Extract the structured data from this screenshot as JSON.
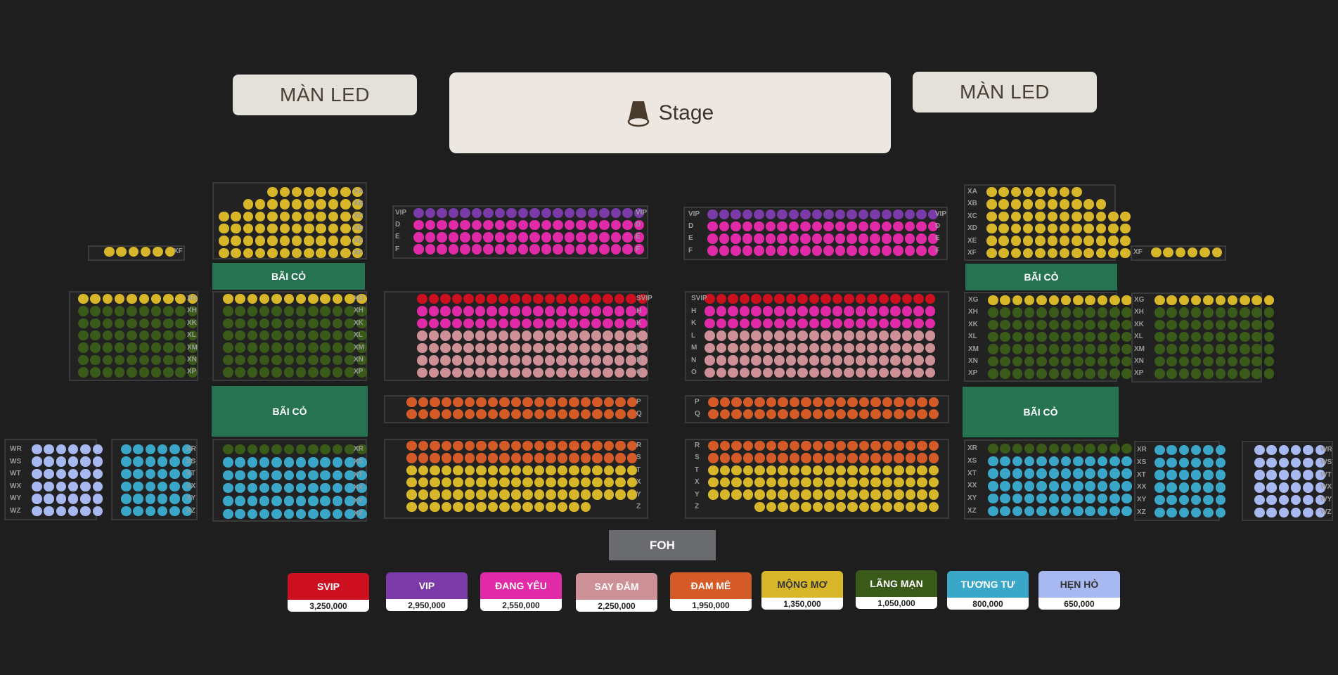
{
  "colors": {
    "svip": "#cc1020",
    "vip": "#7a3aa8",
    "dang_yeu": "#e02aa8",
    "say_dam": "#cc9096",
    "dam_me": "#d45a28",
    "mong_mo": "#d8b62a",
    "lang_man": "#3a5a1a",
    "tuong_tu": "#3aa6c8",
    "hen_ho": "#a8b8f0"
  },
  "screens": {
    "left_label": "MÀN LED",
    "right_label": "MÀN LED"
  },
  "stage": {
    "icon": "spotlight-icon",
    "label": "Stage"
  },
  "grass_label": "BÃI CỎ",
  "foh_label": "FOH",
  "sections": [
    {
      "id": "far-left-xf",
      "rows": [
        {
          "label": "XF",
          "count": 6,
          "color": "mong_mo"
        }
      ],
      "labels_right": true
    },
    {
      "id": "far-left-mid",
      "rows": [
        {
          "label": "XG",
          "count": 10,
          "color": "mong_mo"
        },
        {
          "label": "XH",
          "count": 10,
          "color": "lang_man"
        },
        {
          "label": "XK",
          "count": 10,
          "color": "lang_man"
        },
        {
          "label": "XL",
          "count": 10,
          "color": "lang_man"
        },
        {
          "label": "XM",
          "count": 10,
          "color": "lang_man"
        },
        {
          "label": "XN",
          "count": 10,
          "color": "lang_man"
        },
        {
          "label": "XP",
          "count": 10,
          "color": "lang_man"
        }
      ],
      "labels_right": true
    },
    {
      "id": "far-left-bottom-a",
      "rows": [
        {
          "label": "WR",
          "count": 6,
          "color": "hen_ho"
        },
        {
          "label": "WS",
          "count": 6,
          "color": "hen_ho"
        },
        {
          "label": "WT",
          "count": 6,
          "color": "hen_ho"
        },
        {
          "label": "WX",
          "count": 6,
          "color": "hen_ho"
        },
        {
          "label": "WY",
          "count": 6,
          "color": "hen_ho"
        },
        {
          "label": "WZ",
          "count": 6,
          "color": "hen_ho"
        }
      ],
      "labels_right": false
    },
    {
      "id": "far-left-bottom-b",
      "rows": [
        {
          "label": "XR",
          "count": 6,
          "color": "tuong_tu"
        },
        {
          "label": "XS",
          "count": 6,
          "color": "tuong_tu"
        },
        {
          "label": "XT",
          "count": 6,
          "color": "tuong_tu"
        },
        {
          "label": "XX",
          "count": 6,
          "color": "tuong_tu"
        },
        {
          "label": "XY",
          "count": 6,
          "color": "tuong_tu"
        },
        {
          "label": "XZ",
          "count": 6,
          "color": "tuong_tu"
        }
      ],
      "labels_right": true
    },
    {
      "id": "left-top",
      "rows": [
        {
          "label": "XA",
          "count": 8,
          "color": "mong_mo"
        },
        {
          "label": "XB",
          "count": 10,
          "color": "mong_mo"
        },
        {
          "label": "XC",
          "count": 12,
          "color": "mong_mo"
        },
        {
          "label": "XD",
          "count": 12,
          "color": "mong_mo"
        },
        {
          "label": "XE",
          "count": 12,
          "color": "mong_mo"
        },
        {
          "label": "XF",
          "count": 12,
          "color": "mong_mo"
        }
      ],
      "labels_right": true
    },
    {
      "id": "left-mid",
      "rows": [
        {
          "label": "XG",
          "count": 12,
          "color": "mong_mo"
        },
        {
          "label": "XH",
          "count": 12,
          "color": "lang_man"
        },
        {
          "label": "XK",
          "count": 12,
          "color": "lang_man"
        },
        {
          "label": "XL",
          "count": 12,
          "color": "lang_man"
        },
        {
          "label": "XM",
          "count": 12,
          "color": "lang_man"
        },
        {
          "label": "XN",
          "count": 12,
          "color": "lang_man"
        },
        {
          "label": "XP",
          "count": 12,
          "color": "lang_man"
        }
      ],
      "labels_right": true
    },
    {
      "id": "left-bottom",
      "rows": [
        {
          "label": "XR",
          "count": 12,
          "color": "lang_man"
        },
        {
          "label": "XS",
          "count": 12,
          "color": "tuong_tu"
        },
        {
          "label": "XT",
          "count": 12,
          "color": "tuong_tu"
        },
        {
          "label": "XX",
          "count": 12,
          "color": "tuong_tu"
        },
        {
          "label": "XY",
          "count": 12,
          "color": "tuong_tu"
        },
        {
          "label": "XZ",
          "count": 12,
          "color": "tuong_tu"
        }
      ],
      "labels_right": true
    },
    {
      "id": "center-left-vip",
      "rows": [
        {
          "label": "VIP",
          "count": 20,
          "color": "vip"
        },
        {
          "label": "D",
          "count": 20,
          "color": "dang_yeu"
        },
        {
          "label": "E",
          "count": 20,
          "color": "dang_yeu"
        },
        {
          "label": "F",
          "count": 20,
          "color": "dang_yeu"
        }
      ],
      "labels_both": true
    },
    {
      "id": "center-right-vip",
      "rows": [
        {
          "label": "VIP",
          "count": 20,
          "color": "vip"
        },
        {
          "label": "D",
          "count": 20,
          "color": "dang_yeu"
        },
        {
          "label": "E",
          "count": 20,
          "color": "dang_yeu"
        },
        {
          "label": "F",
          "count": 20,
          "color": "dang_yeu"
        }
      ],
      "labels_both": true
    },
    {
      "id": "center-left-mid",
      "rows": [
        {
          "label": "SVIP",
          "count": 20,
          "color": "svip"
        },
        {
          "label": "H",
          "count": 20,
          "color": "dang_yeu"
        },
        {
          "label": "K",
          "count": 20,
          "color": "dang_yeu"
        },
        {
          "label": "L",
          "count": 20,
          "color": "say_dam"
        },
        {
          "label": "M",
          "count": 20,
          "color": "say_dam"
        },
        {
          "label": "N",
          "count": 20,
          "color": "say_dam"
        },
        {
          "label": "O",
          "count": 20,
          "color": "say_dam"
        }
      ],
      "labels_right": true
    },
    {
      "id": "center-right-mid",
      "rows": [
        {
          "label": "SVIP",
          "count": 20,
          "color": "svip"
        },
        {
          "label": "H",
          "count": 20,
          "color": "dang_yeu"
        },
        {
          "label": "K",
          "count": 20,
          "color": "dang_yeu"
        },
        {
          "label": "L",
          "count": 20,
          "color": "say_dam"
        },
        {
          "label": "M",
          "count": 20,
          "color": "say_dam"
        },
        {
          "label": "N",
          "count": 20,
          "color": "say_dam"
        },
        {
          "label": "O",
          "count": 20,
          "color": "say_dam"
        }
      ],
      "labels_right": false
    },
    {
      "id": "center-left-pq",
      "rows": [
        {
          "label": "P",
          "count": 20,
          "color": "dam_me"
        },
        {
          "label": "Q",
          "count": 20,
          "color": "dam_me"
        }
      ],
      "labels_right": true
    },
    {
      "id": "center-right-pq",
      "rows": [
        {
          "label": "P",
          "count": 20,
          "color": "dam_me"
        },
        {
          "label": "Q",
          "count": 20,
          "color": "dam_me"
        }
      ],
      "labels_right": false
    },
    {
      "id": "center-left-bottom",
      "rows": [
        {
          "label": "R",
          "count": 20,
          "color": "dam_me"
        },
        {
          "label": "S",
          "count": 20,
          "color": "dam_me"
        },
        {
          "label": "T",
          "count": 20,
          "color": "mong_mo"
        },
        {
          "label": "X",
          "count": 20,
          "color": "mong_mo"
        },
        {
          "label": "Y",
          "count": 20,
          "color": "mong_mo"
        },
        {
          "label": "Z",
          "count": 16,
          "color": "mong_mo"
        }
      ],
      "labels_right": true
    },
    {
      "id": "center-right-bottom",
      "rows": [
        {
          "label": "R",
          "count": 20,
          "color": "dam_me"
        },
        {
          "label": "S",
          "count": 20,
          "color": "dam_me"
        },
        {
          "label": "T",
          "count": 20,
          "color": "mong_mo"
        },
        {
          "label": "X",
          "count": 20,
          "color": "mong_mo"
        },
        {
          "label": "Y",
          "count": 20,
          "color": "mong_mo"
        },
        {
          "label": "Z",
          "count": 16,
          "color": "mong_mo"
        }
      ],
      "labels_right": false
    },
    {
      "id": "right-top",
      "rows": [
        {
          "label": "XA",
          "count": 8,
          "color": "mong_mo"
        },
        {
          "label": "XB",
          "count": 10,
          "color": "mong_mo"
        },
        {
          "label": "XC",
          "count": 12,
          "color": "mong_mo"
        },
        {
          "label": "XD",
          "count": 12,
          "color": "mong_mo"
        },
        {
          "label": "XE",
          "count": 12,
          "color": "mong_mo"
        },
        {
          "label": "XF",
          "count": 12,
          "color": "mong_mo"
        }
      ],
      "labels_right": false
    },
    {
      "id": "right-mid",
      "rows": [
        {
          "label": "XG",
          "count": 12,
          "color": "mong_mo"
        },
        {
          "label": "XH",
          "count": 12,
          "color": "lang_man"
        },
        {
          "label": "XK",
          "count": 12,
          "color": "lang_man"
        },
        {
          "label": "XL",
          "count": 12,
          "color": "lang_man"
        },
        {
          "label": "XM",
          "count": 12,
          "color": "lang_man"
        },
        {
          "label": "XN",
          "count": 12,
          "color": "lang_man"
        },
        {
          "label": "XP",
          "count": 12,
          "color": "lang_man"
        }
      ],
      "labels_right": false
    },
    {
      "id": "right-bottom",
      "rows": [
        {
          "label": "XR",
          "count": 12,
          "color": "lang_man"
        },
        {
          "label": "XS",
          "count": 12,
          "color": "tuong_tu"
        },
        {
          "label": "XT",
          "count": 12,
          "color": "tuong_tu"
        },
        {
          "label": "XX",
          "count": 12,
          "color": "tuong_tu"
        },
        {
          "label": "XY",
          "count": 12,
          "color": "tuong_tu"
        },
        {
          "label": "XZ",
          "count": 12,
          "color": "tuong_tu"
        }
      ],
      "labels_right": false
    },
    {
      "id": "far-right-xf",
      "rows": [
        {
          "label": "XF",
          "count": 6,
          "color": "mong_mo"
        }
      ],
      "labels_right": false
    },
    {
      "id": "far-right-mid",
      "rows": [
        {
          "label": "XG",
          "count": 10,
          "color": "mong_mo"
        },
        {
          "label": "XH",
          "count": 10,
          "color": "lang_man"
        },
        {
          "label": "XK",
          "count": 10,
          "color": "lang_man"
        },
        {
          "label": "XL",
          "count": 10,
          "color": "lang_man"
        },
        {
          "label": "XM",
          "count": 10,
          "color": "lang_man"
        },
        {
          "label": "XN",
          "count": 10,
          "color": "lang_man"
        },
        {
          "label": "XP",
          "count": 10,
          "color": "lang_man"
        }
      ],
      "labels_right": false
    },
    {
      "id": "far-right-bottom-a",
      "rows": [
        {
          "label": "XR",
          "count": 6,
          "color": "tuong_tu"
        },
        {
          "label": "XS",
          "count": 6,
          "color": "tuong_tu"
        },
        {
          "label": "XT",
          "count": 6,
          "color": "tuong_tu"
        },
        {
          "label": "XX",
          "count": 6,
          "color": "tuong_tu"
        },
        {
          "label": "XY",
          "count": 6,
          "color": "tuong_tu"
        },
        {
          "label": "XZ",
          "count": 6,
          "color": "tuong_tu"
        }
      ],
      "labels_right": false
    },
    {
      "id": "far-right-bottom-b",
      "rows": [
        {
          "label": "WR",
          "count": 6,
          "color": "hen_ho"
        },
        {
          "label": "WS",
          "count": 6,
          "color": "hen_ho"
        },
        {
          "label": "WT",
          "count": 6,
          "color": "hen_ho"
        },
        {
          "label": "WX",
          "count": 6,
          "color": "hen_ho"
        },
        {
          "label": "WY",
          "count": 6,
          "color": "hen_ho"
        },
        {
          "label": "WZ",
          "count": 6,
          "color": "hen_ho"
        }
      ],
      "labels_right": true
    }
  ],
  "legend": [
    {
      "label": "SVIP",
      "price": "3,250,000",
      "color": "svip"
    },
    {
      "label": "VIP",
      "price": "2,950,000",
      "color": "vip"
    },
    {
      "label": "ĐANG YÊU",
      "price": "2,550,000",
      "color": "dang_yeu"
    },
    {
      "label": "SAY ĐẮM",
      "price": "2,250,000",
      "color": "say_dam"
    },
    {
      "label": "ĐAM MÊ",
      "price": "1,950,000",
      "color": "dam_me"
    },
    {
      "label": "MỘNG MƠ",
      "price": "1,350,000",
      "color": "mong_mo"
    },
    {
      "label": "LÃNG MẠN",
      "price": "1,050,000",
      "color": "lang_man"
    },
    {
      "label": "TƯƠNG TƯ",
      "price": "800,000",
      "color": "tuong_tu"
    },
    {
      "label": "HẸN HÒ",
      "price": "650,000",
      "color": "hen_ho"
    }
  ]
}
